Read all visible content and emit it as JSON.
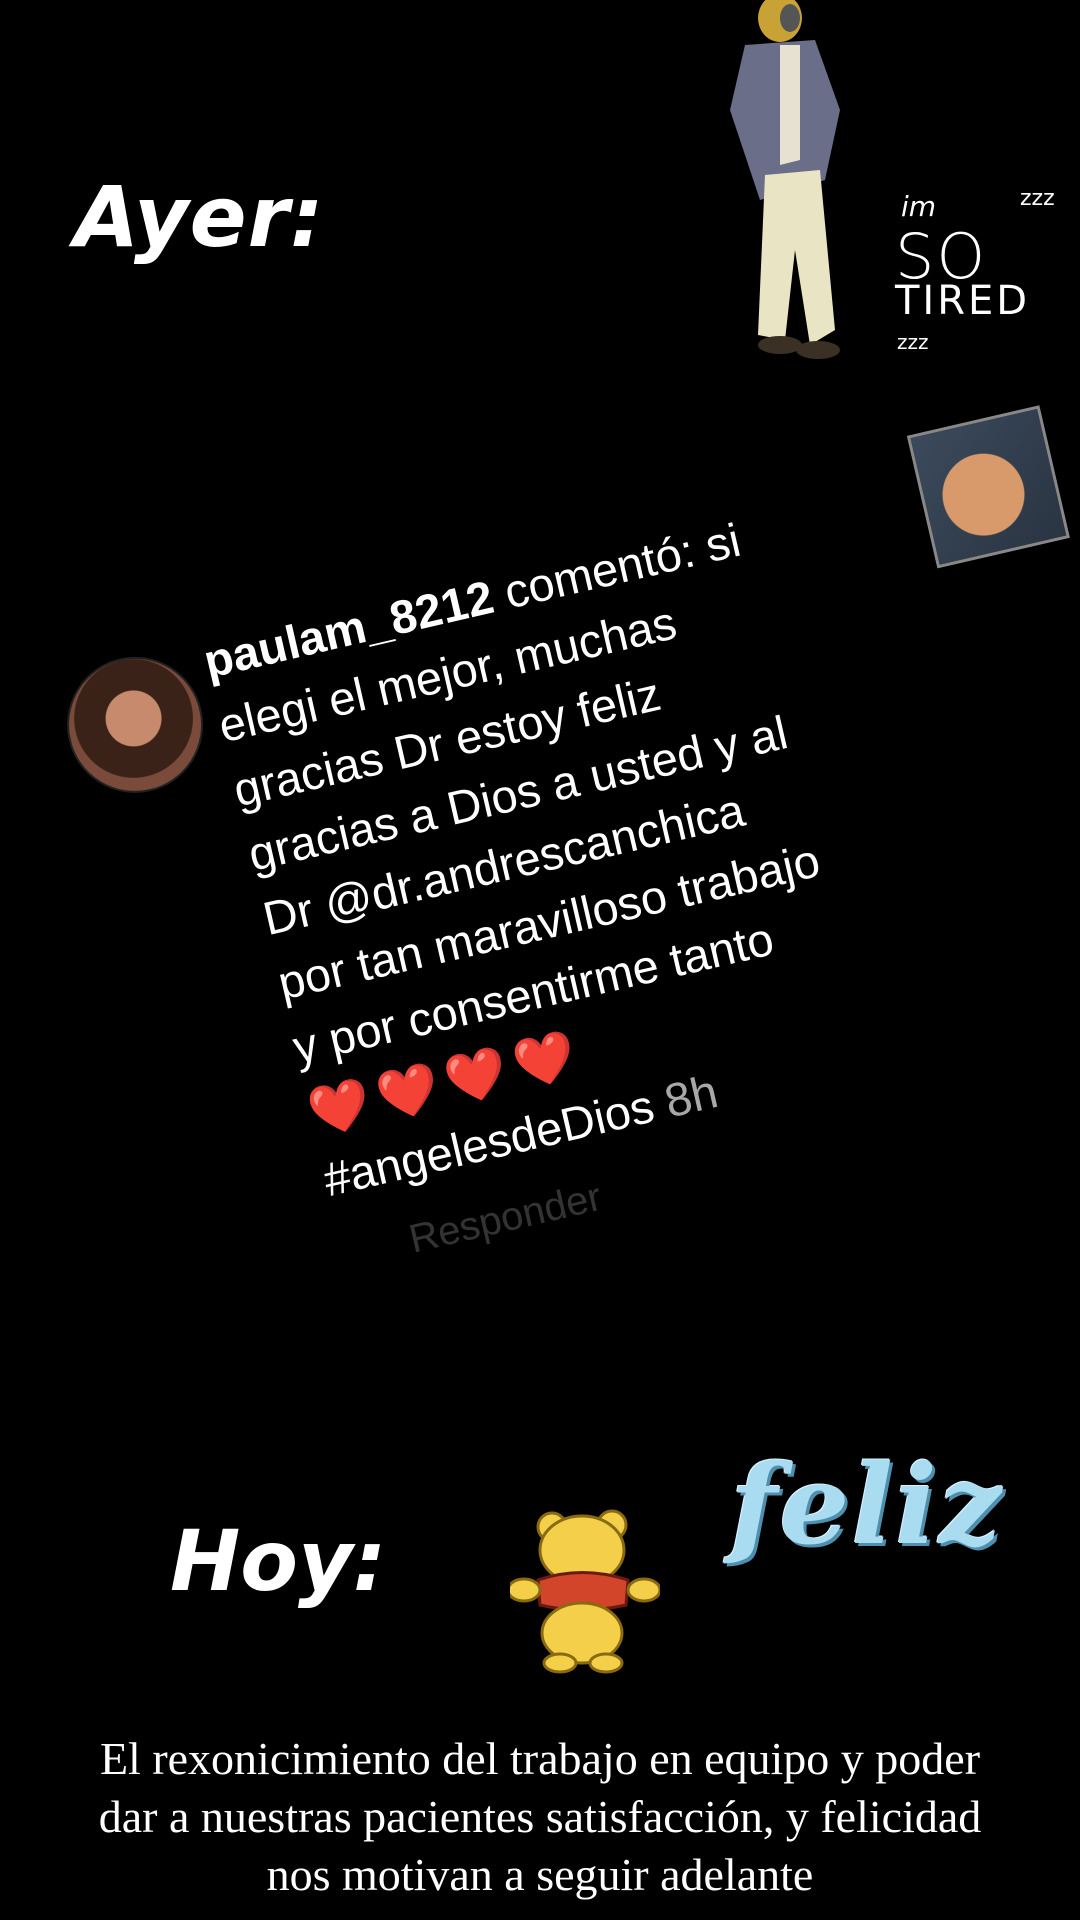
{
  "story": {
    "ayer_label": "Ayer:",
    "hoy_label": "Hoy:",
    "tired_sticker": {
      "im": "im",
      "so": "SO",
      "tired": "TIRED",
      "zzz_top": "zzz",
      "zzz_bottom": "zzz"
    },
    "feliz_sticker": "feliz",
    "caption_lines": [
      "El rexonicimiento del trabajo en equipo y poder",
      "dar a nuestras pacientes satisfacción, y felicidad",
      "nos motivan a seguir adelante"
    ]
  },
  "comment": {
    "username": "paulam_8212",
    "line1_rest": " comentó: si",
    "lines": [
      "elegi el mejor, muchas",
      "gracias Dr estoy feliz",
      "gracias a Dios a usted y al",
      "Dr @dr.andrescanchica",
      "por tan maravilloso trabajo",
      "y por consentirme tanto"
    ],
    "hearts": "❤️❤️❤️❤️",
    "hashtag": "#angelesdeDios",
    "time": " 8h",
    "reply_faded": "Responder"
  },
  "colors": {
    "background": "#000000",
    "text": "#ffffff",
    "time_gray": "#a8a8a8",
    "feliz_blue": "#a9dcf0",
    "heart_red": "#ff1e1e"
  },
  "icons": {
    "avatar": "user-avatar",
    "post_thumbnail": "post-thumbnail",
    "pooh": "pooh-sticker",
    "man": "man-sticker"
  }
}
